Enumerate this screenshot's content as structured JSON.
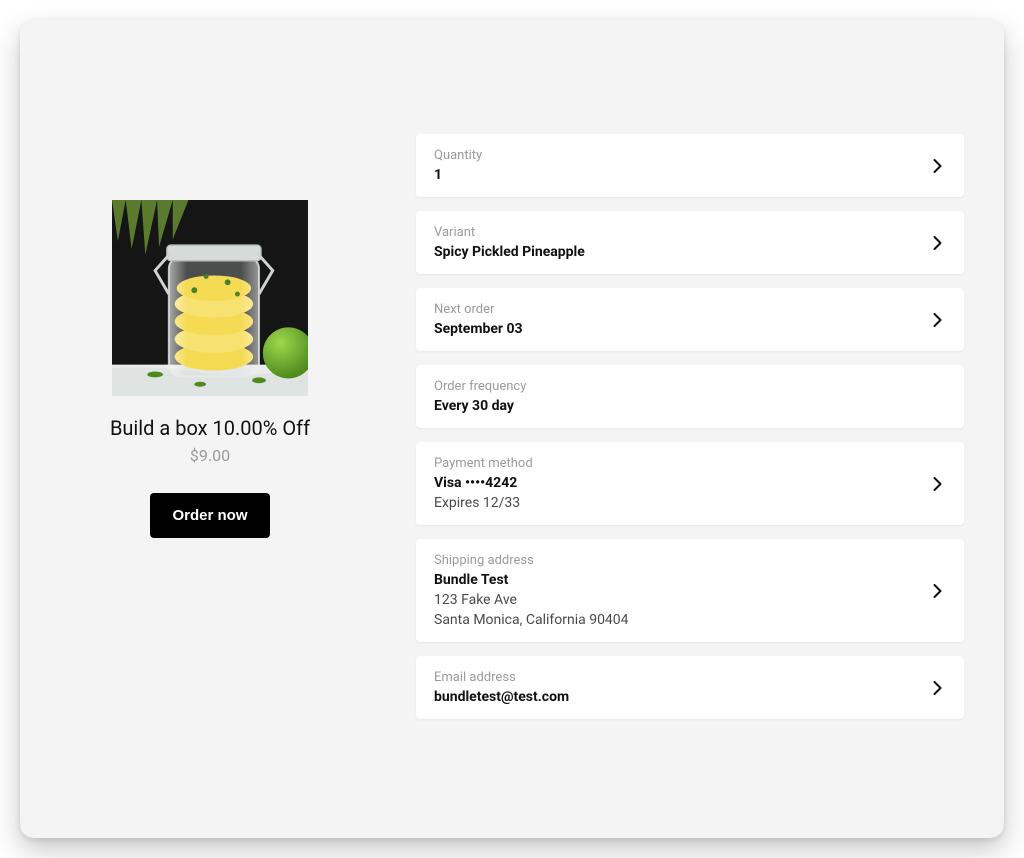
{
  "product": {
    "title": "Build a box 10.00% Off",
    "price": "$9.00",
    "order_button": "Order now",
    "image_alt": "Jar of pickled pineapple slices"
  },
  "details": {
    "quantity": {
      "label": "Quantity",
      "value": "1"
    },
    "variant": {
      "label": "Variant",
      "value": "Spicy Pickled Pineapple"
    },
    "next_order": {
      "label": "Next order",
      "value": "September 03"
    },
    "order_frequency": {
      "label": "Order frequency",
      "value": "Every 30 day"
    },
    "payment_method": {
      "label": "Payment method",
      "card_line": "Visa ••••4242",
      "expiry_line": "Expires 12/33"
    },
    "shipping_address": {
      "label": "Shipping address",
      "name": "Bundle Test",
      "line1": "123 Fake Ave",
      "line2": "Santa Monica, California 90404"
    },
    "email": {
      "label": "Email address",
      "value": "bundletest@test.com"
    }
  }
}
